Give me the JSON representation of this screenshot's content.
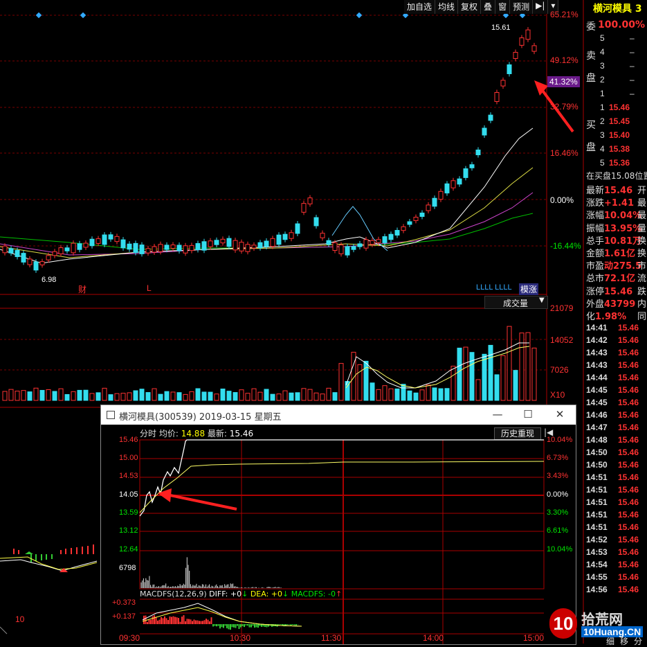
{
  "toolbar": {
    "items": [
      "加自选",
      "均线",
      "复权",
      "叠",
      "窗",
      "预测",
      "▶|",
      "▾"
    ]
  },
  "quote": {
    "title": "横河模具 3",
    "sell_label_1": "卖",
    "sell_label_2": "盘",
    "buy_label_1": "买",
    "buy_label_2": "盘",
    "committee_ratio": "100.00%",
    "committee_label": "委",
    "asks": [
      {
        "level": "5",
        "price": "–"
      },
      {
        "level": "4",
        "price": "–"
      },
      {
        "level": "3",
        "price": "–"
      },
      {
        "level": "2",
        "price": "–"
      },
      {
        "level": "1",
        "price": "–"
      }
    ],
    "bids": [
      {
        "level": "1",
        "price": "15.46"
      },
      {
        "level": "2",
        "price": "15.45"
      },
      {
        "level": "3",
        "price": "15.40"
      },
      {
        "level": "4",
        "price": "15.38"
      },
      {
        "level": "5",
        "price": "15.36"
      }
    ],
    "stats_header": "在买盘15.08位置",
    "stats": [
      {
        "label": "最新",
        "value": "15.46",
        "tail": "开"
      },
      {
        "label": "涨跌",
        "value": "+1.41",
        "tail": "最"
      },
      {
        "label": "涨幅",
        "value": "10.04%",
        "tail": "最"
      },
      {
        "label": "振幅",
        "value": "13.95%",
        "tail": "量"
      },
      {
        "label": "总手",
        "value": "10.81万",
        "tail": "换"
      },
      {
        "label": "金额",
        "value": "1.61亿",
        "tail": "换"
      },
      {
        "label": "市盈",
        "value": "动275.5",
        "tail": "市"
      },
      {
        "label": "总市",
        "value": "72.1亿",
        "tail": "流"
      },
      {
        "label": "涨停",
        "value": "15.46",
        "tail": "跌"
      },
      {
        "label": "外盘",
        "value": "43799",
        "tail": "内"
      },
      {
        "label": "化",
        "value": "1.98%",
        "tail": "同"
      }
    ],
    "ticks": [
      {
        "time": "14:41",
        "price": "15.46"
      },
      {
        "time": "14:42",
        "price": "15.46"
      },
      {
        "time": "14:43",
        "price": "15.46"
      },
      {
        "time": "14:43",
        "price": "15.46"
      },
      {
        "time": "14:44",
        "price": "15.46"
      },
      {
        "time": "14:45",
        "price": "15.46"
      },
      {
        "time": "14:45",
        "price": "15.46"
      },
      {
        "time": "14:46",
        "price": "15.46"
      },
      {
        "time": "14:47",
        "price": "15.46"
      },
      {
        "time": "14:48",
        "price": "15.46"
      },
      {
        "time": "14:50",
        "price": "15.46"
      },
      {
        "time": "14:50",
        "price": "15.46"
      },
      {
        "time": "14:51",
        "price": "15.46"
      },
      {
        "time": "14:51",
        "price": "15.46"
      },
      {
        "time": "14:51",
        "price": "15.46"
      },
      {
        "time": "14:51",
        "price": "15.46"
      },
      {
        "time": "14:51",
        "price": "15.46"
      },
      {
        "time": "14:52",
        "price": "15.46"
      },
      {
        "time": "14:53",
        "price": "15.46"
      },
      {
        "time": "14:54",
        "price": "15.46"
      },
      {
        "time": "14:55",
        "price": "15.46"
      },
      {
        "time": "14:56",
        "price": "15.46"
      }
    ],
    "bottom_tabs": [
      "细",
      "移",
      "分"
    ]
  },
  "main_chart": {
    "pct_axis": [
      "65.21%",
      "49.12%",
      "41.32%",
      "32.79%",
      "16.46%",
      "0.00%",
      "-16.44%"
    ],
    "high_label": "15.61",
    "low_label": "6.98",
    "markers": [
      "财",
      "L"
    ],
    "badge": "模涨",
    "badge_prefix": "LLLL LLLL"
  },
  "volume_chart": {
    "dropdown_label": "成交量",
    "axis": [
      "21079",
      "14052",
      "7026",
      "X10"
    ]
  },
  "popup": {
    "title": "横河模具(300539) 2019-03-15 星期五",
    "btn_min": "—",
    "btn_max": "☐",
    "btn_close": "✕",
    "header_1": "分时",
    "header_2": "均价:",
    "avg_price": "14.88",
    "header_3": "最新:",
    "latest_price": "15.46",
    "history_btn": "历史重现",
    "left_axis": [
      "15.46",
      "15.00",
      "14.53",
      "14.05",
      "13.59",
      "13.12",
      "12.64",
      "6798"
    ],
    "right_axis": [
      "10.04%",
      "6.73%",
      "3.43%",
      "0.00%",
      "3.30%",
      "6.61%",
      "10.04%"
    ],
    "macd_header": "MACDFS(12,26,9)",
    "macd_diff": "DIFF: +0",
    "macd_dea": "DEA: +0",
    "macd_fs": "MACDFS: -0",
    "macd_axis": [
      "+0.373",
      "+0.137"
    ],
    "time_axis": [
      "09:30",
      "10:30",
      "11:30",
      "14:00",
      "15:00"
    ]
  },
  "left_panel": {
    "axis_10": "10"
  },
  "watermark": {
    "text_1": "拾荒网",
    "text_2": "10Huang.CN"
  }
}
